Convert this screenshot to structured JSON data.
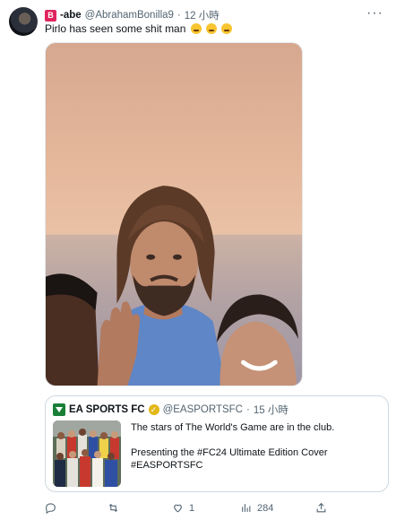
{
  "tweet": {
    "badge": "B",
    "display_name": "-abe",
    "handle": "@AbrahamBonilla9",
    "separator": "·",
    "time": "12 小時",
    "text": "Pirlo has seen some shit man",
    "emojis": [
      "crying-face",
      "crying-face",
      "rolling-on-floor-laughing"
    ],
    "more_label": "···"
  },
  "quoted": {
    "display_name": "EA SPORTS FC",
    "handle": "@EASPORTSFC",
    "separator": "·",
    "time": "15 小時",
    "line1": "The stars of The World's Game are in the club.",
    "line2": "Presenting the #FC24 Ultimate Edition Cover",
    "line3": "#EASPORTSFC"
  },
  "actions": {
    "reply_count": "",
    "retweet_count": "",
    "like_count": "1",
    "views_count": "284"
  },
  "colors": {
    "text": "#0f1419",
    "muted": "#536471",
    "border": "#cfd9de",
    "badge": "#e0245e",
    "ea_green": "#1a7f37",
    "verified_gold": "#e2b719"
  }
}
